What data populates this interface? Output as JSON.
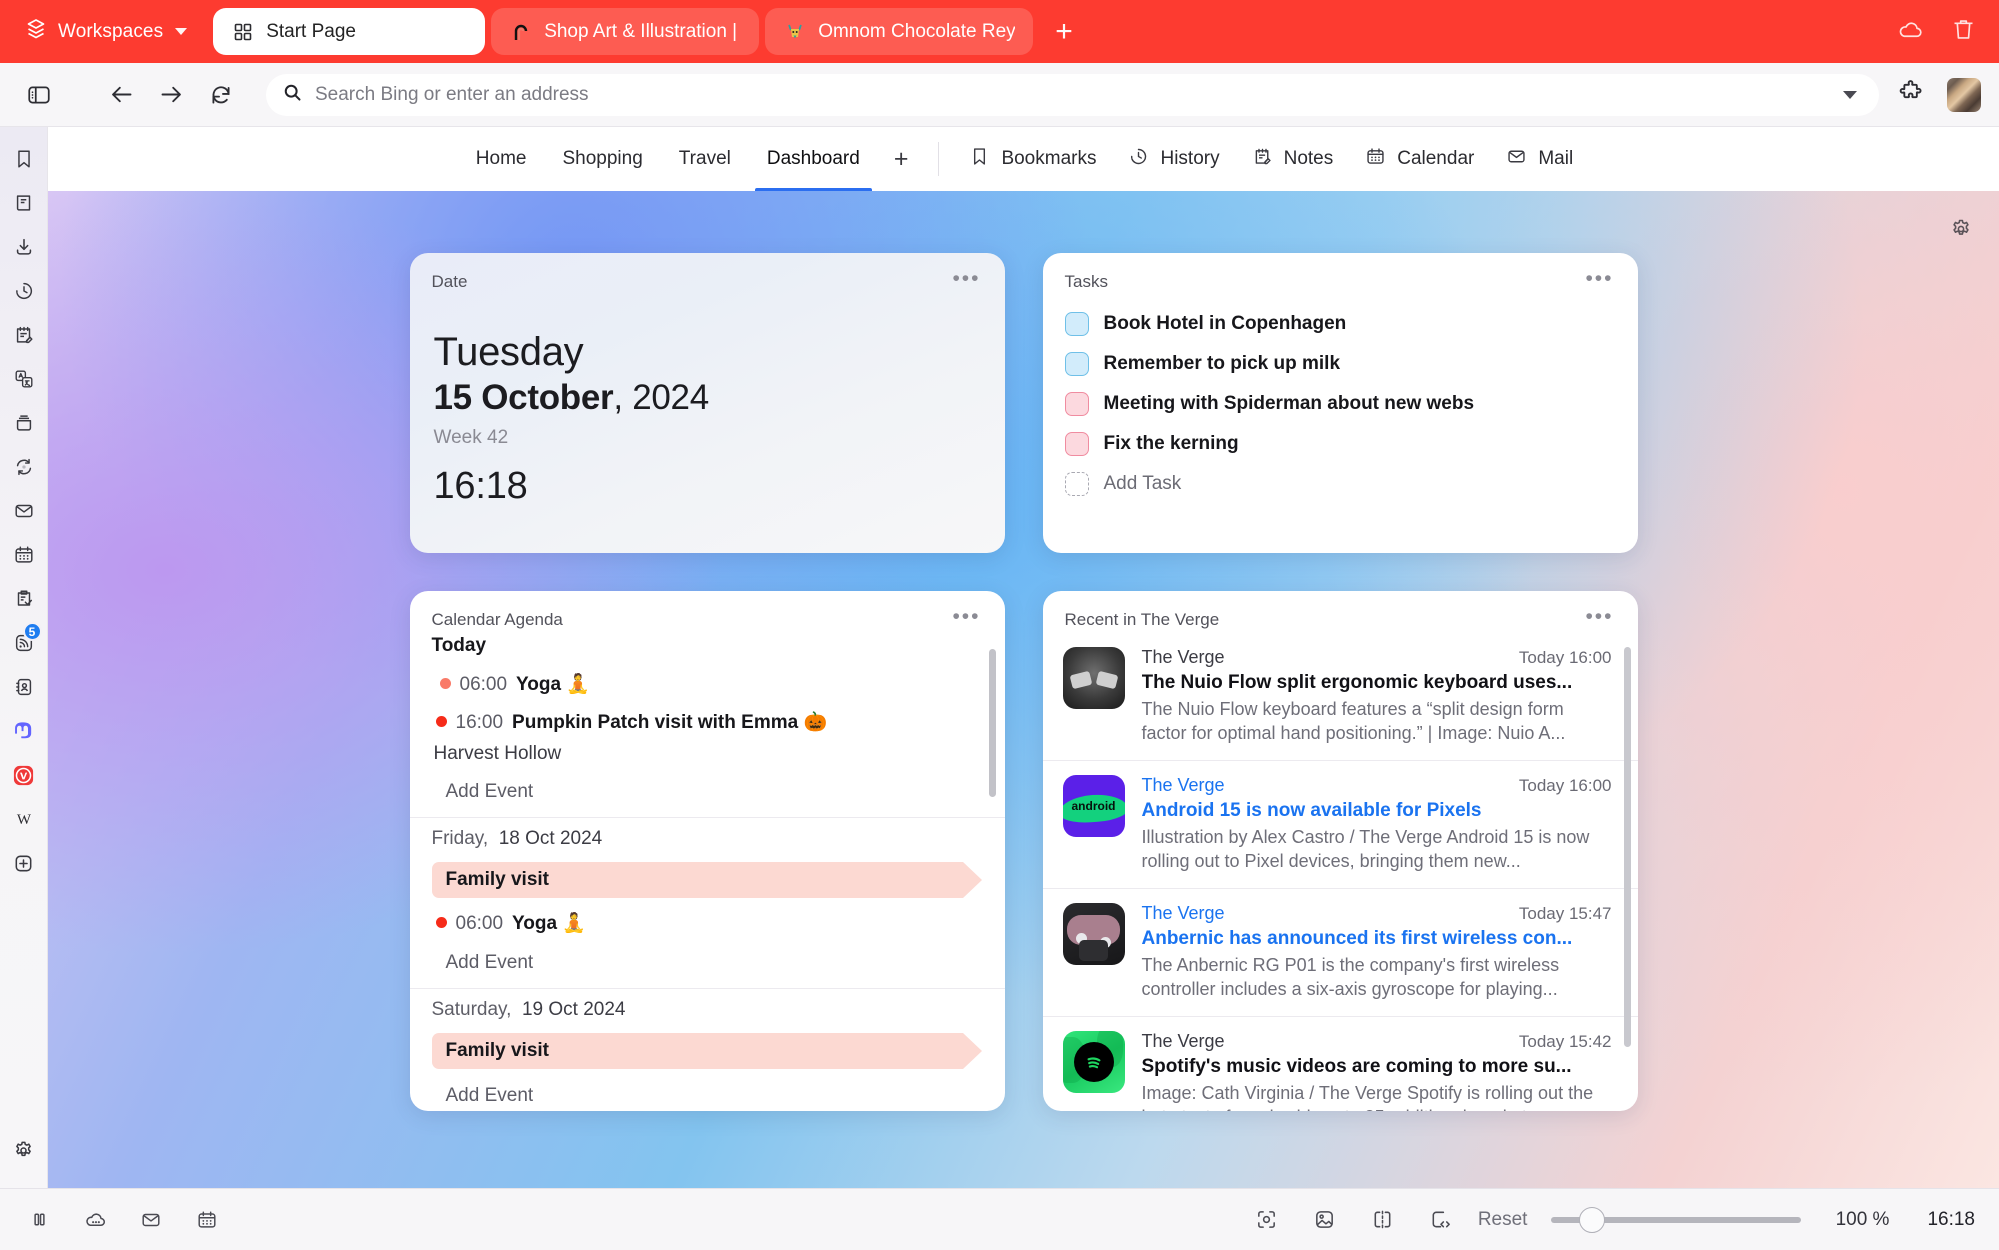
{
  "window": {
    "accent_color": "#fd3b30",
    "workspaces_label": "Workspaces",
    "tabs": [
      {
        "title": "Start Page",
        "favicon": "grid-icon",
        "active": true
      },
      {
        "title": "Shop Art & Illustration | Lis",
        "favicon": "arch-icon",
        "active": false
      },
      {
        "title": "Omnom Chocolate Reykjav",
        "favicon": "goat-icon",
        "active": false
      }
    ],
    "new_tab_label": "+",
    "right_icons": [
      "cloud-icon",
      "trash-icon"
    ]
  },
  "addressbar": {
    "placeholder": "Search Bing or enter an address",
    "value": "",
    "search_icon": "search-icon",
    "back_icon": "arrow-left-icon",
    "forward_icon": "arrow-right-icon",
    "reload_icon": "reload-icon",
    "panel_icon": "panel-toggle-icon",
    "dropdown_icon": "chevron-down-icon",
    "extensions_icon": "puzzle-icon",
    "profile_icon": "avatar"
  },
  "rail": {
    "items": [
      {
        "name": "bookmarks",
        "icon": "bookmark-icon"
      },
      {
        "name": "reading-list",
        "icon": "book-icon"
      },
      {
        "name": "downloads",
        "icon": "download-icon"
      },
      {
        "name": "history",
        "icon": "history-icon"
      },
      {
        "name": "notes",
        "icon": "notes-edit-icon"
      },
      {
        "name": "translate",
        "icon": "translate-icon"
      },
      {
        "name": "window-panel",
        "icon": "window-icon"
      },
      {
        "name": "sync",
        "icon": "sync-icon"
      },
      {
        "name": "mail",
        "icon": "mail-icon"
      },
      {
        "name": "calendar",
        "icon": "calendar-icon"
      },
      {
        "name": "tasks",
        "icon": "clipboard-check-icon"
      },
      {
        "name": "feeds",
        "icon": "rss-icon",
        "badge": "5"
      },
      {
        "name": "contacts",
        "icon": "contacts-icon"
      },
      {
        "name": "mastodon",
        "icon": "mastodon-icon"
      },
      {
        "name": "vivaldi",
        "icon": "vivaldi-icon"
      },
      {
        "name": "wikipedia",
        "icon": "wikipedia-icon"
      },
      {
        "name": "add-panel",
        "icon": "plus-box-icon"
      }
    ],
    "settings": {
      "name": "settings",
      "icon": "gear-icon"
    }
  },
  "navtabs": {
    "pages": [
      {
        "label": "Home",
        "selected": false
      },
      {
        "label": "Shopping",
        "selected": false
      },
      {
        "label": "Travel",
        "selected": false
      },
      {
        "label": "Dashboard",
        "selected": true
      }
    ],
    "add_label": "+",
    "links": [
      {
        "label": "Bookmarks",
        "icon": "bookmark-icon"
      },
      {
        "label": "History",
        "icon": "history-icon"
      },
      {
        "label": "Notes",
        "icon": "notes-edit-icon"
      },
      {
        "label": "Calendar",
        "icon": "calendar-icon"
      },
      {
        "label": "Mail",
        "icon": "mail-icon"
      }
    ]
  },
  "dashboard": {
    "settings_icon": "gear-icon",
    "menu_dots": "•••",
    "date_widget": {
      "title": "Date",
      "weekday": "Tuesday",
      "day_month": "15 October",
      "comma_year": ", 2024",
      "week": "Week 42",
      "time": "16:18"
    },
    "tasks_widget": {
      "title": "Tasks",
      "items": [
        {
          "label": "Book Hotel in Copenhagen",
          "color": "blue",
          "done": false
        },
        {
          "label": "Remember to pick up milk",
          "color": "blue",
          "done": false
        },
        {
          "label": "Meeting with Spiderman about new webs",
          "color": "pink",
          "done": false
        },
        {
          "label": "Fix the kerning",
          "color": "pink",
          "done": false
        }
      ],
      "add_label": "Add Task"
    },
    "agenda_widget": {
      "title": "Calendar Agenda",
      "add_event_label": "Add Event",
      "sections": [
        {
          "heading": "Today",
          "heading_day": "",
          "events": [
            {
              "type": "timed",
              "time": "06:00",
              "name": "Yoga 🧘",
              "dot": "#f97a68",
              "location": ""
            },
            {
              "type": "timed",
              "time": "16:00",
              "name": "Pumpkin Patch visit with Emma 🎃",
              "dot": "#f62b19",
              "location": "Harvest Hollow"
            }
          ]
        },
        {
          "heading": "Friday,",
          "heading_day": "18 Oct 2024",
          "events": [
            {
              "type": "allday",
              "name": "Family visit",
              "color": "#fcd9d2"
            },
            {
              "type": "timed",
              "time": "06:00",
              "name": "Yoga 🧘",
              "dot": "#f62b19",
              "location": ""
            }
          ]
        },
        {
          "heading": "Saturday,",
          "heading_day": "19 Oct 2024",
          "events": [
            {
              "type": "allday",
              "name": "Family visit",
              "color": "#fcd9d2"
            }
          ]
        }
      ]
    },
    "feed_widget": {
      "title": "Recent in The Verge",
      "articles": [
        {
          "source": "The Verge",
          "time": "Today 16:00",
          "title": "The Nuio Flow split ergonomic keyboard uses...",
          "description": "The Nuio Flow keyboard features a “split design form factor for optimal hand positioning.” | Image: Nuio A...",
          "read": true,
          "thumb": "keyboard"
        },
        {
          "source": "The Verge",
          "time": "Today 16:00",
          "title": "Android 15 is now available for Pixels",
          "description": "Illustration by Alex Castro / The Verge Android 15 is now rolling out to Pixel devices, bringing them new...",
          "read": false,
          "thumb": "android"
        },
        {
          "source": "The Verge",
          "time": "Today 15:47",
          "title": "Anbernic has announced its first wireless con...",
          "description": "The Anbernic RG P01 is the company's first wireless controller includes a six-axis gyroscope for playing...",
          "read": false,
          "thumb": "gamepad"
        },
        {
          "source": "The Verge",
          "time": "Today 15:42",
          "title": "Spotify's music videos are coming to more su...",
          "description": "Image: Cath Virginia / The Verge Spotify is rolling out the beta test of music videos to 85 additional market...",
          "read": true,
          "thumb": "spotify"
        }
      ]
    }
  },
  "statusbar": {
    "left_icons": [
      "pause-icon",
      "cloud-dots-icon",
      "mail-icon",
      "calendar-icon"
    ],
    "right_icons": [
      "capture-icon",
      "image-icon",
      "tiling-icon",
      "devtools-icon"
    ],
    "reset_label": "Reset",
    "zoom_level": "100 %",
    "clock": "16:18"
  }
}
